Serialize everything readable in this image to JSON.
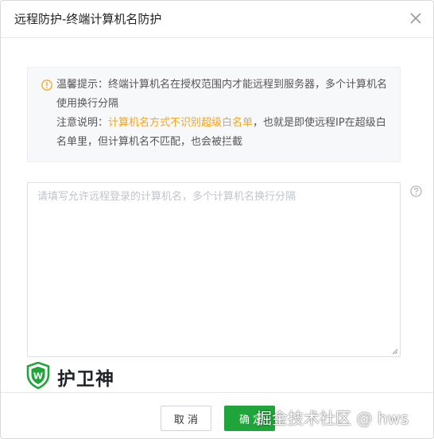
{
  "dialog": {
    "title": "远程防护-终端计算机名防护"
  },
  "notice": {
    "line1": "温馨提示：终端计算机名在授权范围内才能远程到服务器，多个计算机名使用换行分隔",
    "line2_prefix": "注意说明：",
    "line2_highlight": "计算机名方式不识别超级白名单",
    "line2_suffix": "，也就是即使远程IP在超级白名单里，但计算机名不匹配，也会被拦截"
  },
  "input": {
    "placeholder": "请填写允许远程登录的计算机名，多个计算机名换行分隔",
    "value": ""
  },
  "brand": {
    "name": "护卫神",
    "letter": "W"
  },
  "footer": {
    "cancel_label": "取 消",
    "ok_label": "确 定"
  },
  "watermark": "掘金技术社区 @ hws",
  "colors": {
    "accent_green": "#20a53a",
    "warning_orange": "#f5a623"
  },
  "icons": {
    "close": "close-icon",
    "notice": "warning-circle-icon",
    "help": "question-circle-icon",
    "brand": "shield-logo-icon"
  }
}
